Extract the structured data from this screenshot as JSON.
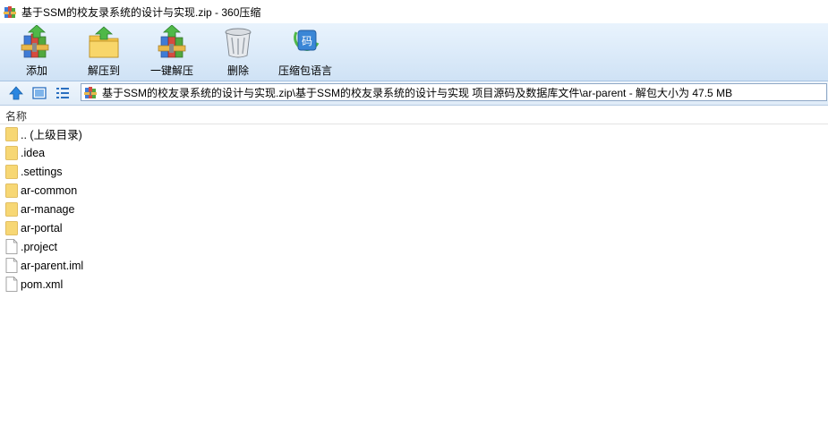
{
  "window": {
    "title": "基于SSM的校友录系统的设计与实现.zip - 360压缩",
    "app_icon": "archive-books-icon"
  },
  "toolbar": {
    "items": [
      {
        "label": "添加",
        "icon": "archive-add-icon"
      },
      {
        "label": "解压到",
        "icon": "folder-extract-icon"
      },
      {
        "label": "一键解压",
        "icon": "archive-oneclick-extract-icon"
      },
      {
        "label": "删除",
        "icon": "trash-bin-icon"
      },
      {
        "label": "压缩包语言",
        "icon": "language-code-icon"
      }
    ]
  },
  "navbar": {
    "up_icon": "up-arrow-icon",
    "view_icon": "thumbnail-view-icon",
    "list_icon": "list-view-icon",
    "address": "基于SSM的校友录系统的设计与实现.zip\\基于SSM的校友录系统的设计与实现 项目源码及数据库文件\\ar-parent - 解包大小为 47.5 MB"
  },
  "list": {
    "column_name": "名称",
    "files": [
      {
        "name": ".. (上级目录)",
        "type": "folder"
      },
      {
        "name": ".idea",
        "type": "folder"
      },
      {
        "name": ".settings",
        "type": "folder"
      },
      {
        "name": "ar-common",
        "type": "folder"
      },
      {
        "name": "ar-manage",
        "type": "folder"
      },
      {
        "name": "ar-portal",
        "type": "folder"
      },
      {
        "name": ".project",
        "type": "file"
      },
      {
        "name": "ar-parent.iml",
        "type": "file"
      },
      {
        "name": "pom.xml",
        "type": "file"
      }
    ]
  },
  "colors": {
    "toolbar_bg": "#dbeaf9",
    "folder": "#f7d774",
    "accent": "#2a7fd4"
  }
}
